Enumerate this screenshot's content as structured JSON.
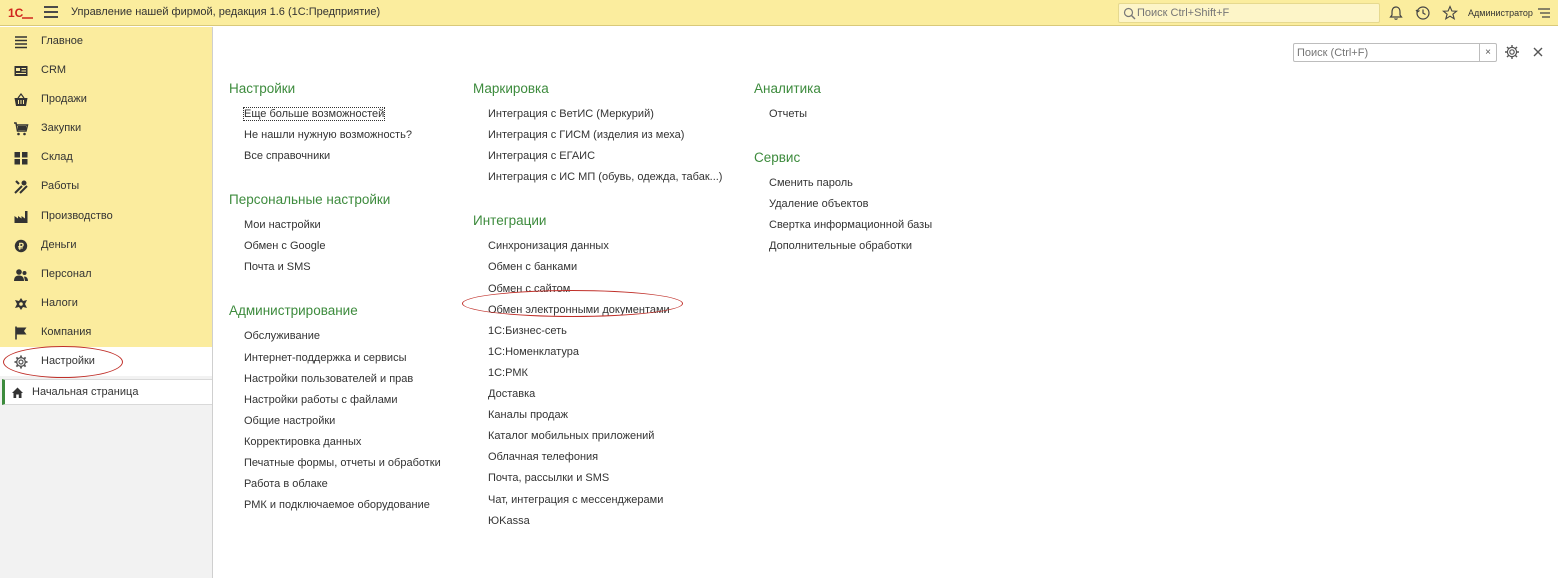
{
  "header": {
    "app_title": "Управление нашей фирмой, редакция 1.6  (1С:Предприятие)",
    "search_placeholder": "Поиск Ctrl+Shift+F",
    "user": "Администратор"
  },
  "sidebar": {
    "items": [
      {
        "label": "Главное",
        "icon": "list-icon"
      },
      {
        "label": "CRM",
        "icon": "contact-card-icon"
      },
      {
        "label": "Продажи",
        "icon": "basket-icon"
      },
      {
        "label": "Закупки",
        "icon": "cart-icon"
      },
      {
        "label": "Склад",
        "icon": "warehouse-icon"
      },
      {
        "label": "Работы",
        "icon": "tools-icon"
      },
      {
        "label": "Производство",
        "icon": "factory-icon"
      },
      {
        "label": "Деньги",
        "icon": "coin-icon"
      },
      {
        "label": "Персонал",
        "icon": "people-icon"
      },
      {
        "label": "Налоги",
        "icon": "emblem-icon"
      },
      {
        "label": "Компания",
        "icon": "flag-icon"
      },
      {
        "label": "Настройки",
        "icon": "gear-icon"
      }
    ],
    "home_label": "Начальная страница"
  },
  "content": {
    "search_placeholder": "Поиск (Ctrl+F)",
    "clear_label": "×",
    "columns": [
      {
        "sections": [
          {
            "title": "Настройки",
            "links": [
              "Еще больше возможностей",
              "Не нашли нужную возможность?",
              "Все справочники"
            ]
          },
          {
            "title": "Персональные настройки",
            "links": [
              "Мои настройки",
              "Обмен с Google",
              "Почта и SMS"
            ]
          },
          {
            "title": "Администрирование",
            "links": [
              "Обслуживание",
              "Интернет-поддержка и сервисы",
              "Настройки пользователей и прав",
              "Настройки работы с файлами",
              "Общие настройки",
              "Корректировка данных",
              "Печатные формы, отчеты и обработки",
              "Работа в облаке",
              "РМК и подключаемое оборудование"
            ]
          }
        ]
      },
      {
        "sections": [
          {
            "title": "Маркировка",
            "links": [
              "Интеграция с ВетИС (Меркурий)",
              "Интеграция с ГИСМ (изделия из меха)",
              "Интеграция с ЕГАИС",
              "Интеграция с ИС МП (обувь, одежда, табак...)"
            ]
          },
          {
            "title": "Интеграции",
            "links": [
              "Синхронизация данных",
              "Обмен с банками",
              "Обмен с сайтом",
              "Обмен электронными документами",
              "1С:Бизнес-сеть",
              "1С:Номенклатура",
              "1С:РМК",
              "Доставка",
              "Каналы продаж",
              "Каталог мобильных приложений",
              "Облачная телефония",
              "Почта, рассылки и SMS",
              "Чат, интеграция с мессенджерами",
              "ЮKassa"
            ]
          }
        ]
      },
      {
        "sections": [
          {
            "title": "Аналитика",
            "links": [
              "Отчеты"
            ]
          },
          {
            "title": "Сервис",
            "links": [
              "Сменить пароль",
              "Удаление объектов",
              "Свертка информационной базы",
              "Дополнительные обработки"
            ]
          }
        ]
      }
    ]
  },
  "colors": {
    "accent_green": "#3d8b3d",
    "panel_yellow": "#fbec9e",
    "highlight_red": "#c0302a"
  }
}
